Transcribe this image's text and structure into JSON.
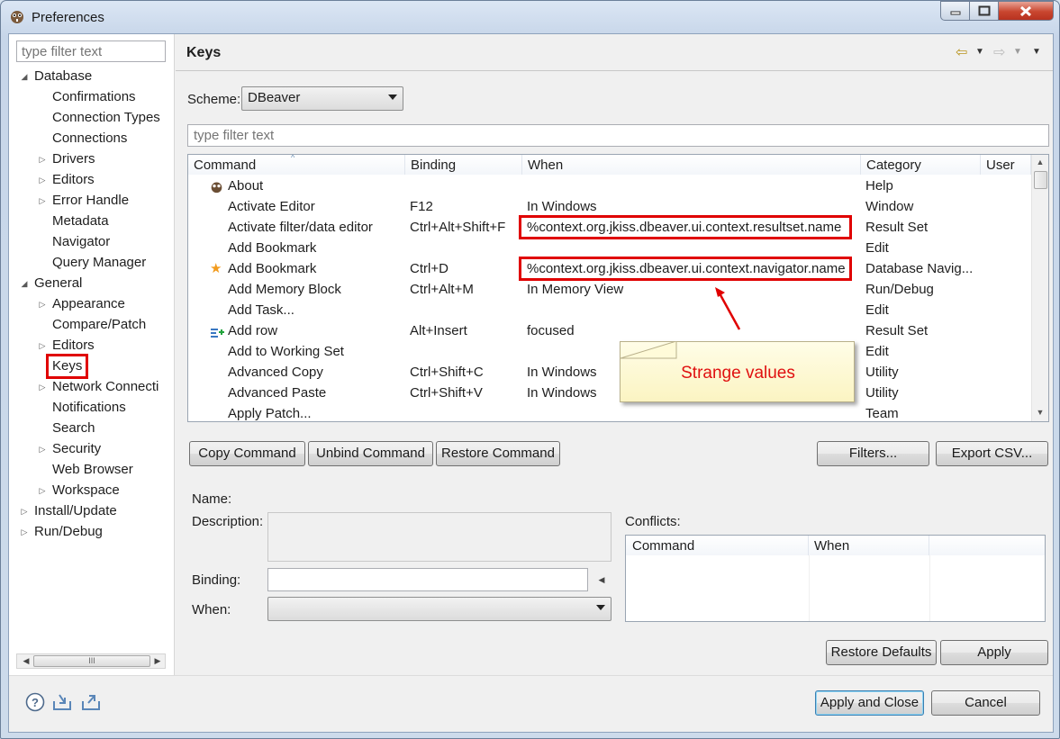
{
  "window": {
    "title": "Preferences"
  },
  "left": {
    "filter_placeholder": "type filter text",
    "tree": [
      {
        "label": "Database",
        "level": 0,
        "expander": "open"
      },
      {
        "label": "Confirmations",
        "level": 1,
        "expander": "none"
      },
      {
        "label": "Connection Types",
        "level": 1,
        "expander": "none"
      },
      {
        "label": "Connections",
        "level": 1,
        "expander": "none"
      },
      {
        "label": "Drivers",
        "level": 1,
        "expander": "closed"
      },
      {
        "label": "Editors",
        "level": 1,
        "expander": "closed"
      },
      {
        "label": "Error Handle",
        "level": 1,
        "expander": "closed"
      },
      {
        "label": "Metadata",
        "level": 1,
        "expander": "none"
      },
      {
        "label": "Navigator",
        "level": 1,
        "expander": "none"
      },
      {
        "label": "Query Manager",
        "level": 1,
        "expander": "none"
      },
      {
        "label": "General",
        "level": 0,
        "expander": "open"
      },
      {
        "label": "Appearance",
        "level": 1,
        "expander": "closed"
      },
      {
        "label": "Compare/Patch",
        "level": 1,
        "expander": "none"
      },
      {
        "label": "Editors",
        "level": 1,
        "expander": "closed"
      },
      {
        "label": "Keys",
        "level": 1,
        "expander": "none",
        "selected": true
      },
      {
        "label": "Network Connecti",
        "level": 1,
        "expander": "closed"
      },
      {
        "label": "Notifications",
        "level": 1,
        "expander": "none"
      },
      {
        "label": "Search",
        "level": 1,
        "expander": "none"
      },
      {
        "label": "Security",
        "level": 1,
        "expander": "closed"
      },
      {
        "label": "Web Browser",
        "level": 1,
        "expander": "none"
      },
      {
        "label": "Workspace",
        "level": 1,
        "expander": "closed"
      },
      {
        "label": "Install/Update",
        "level": 0,
        "expander": "closed"
      },
      {
        "label": "Run/Debug",
        "level": 0,
        "expander": "closed"
      }
    ],
    "scroll_thumb_text": "III"
  },
  "page": {
    "title": "Keys",
    "scheme_label": "Scheme:",
    "scheme_value": "DBeaver",
    "filter_placeholder": "type filter text",
    "columns": [
      "Command",
      "Binding",
      "When",
      "Category",
      "User"
    ],
    "rows": [
      {
        "command": "About",
        "binding": "",
        "when": "",
        "category": "Help",
        "icon": "dbeaver-icon"
      },
      {
        "command": "Activate Editor",
        "binding": "F12",
        "when": "In Windows",
        "category": "Window",
        "icon": ""
      },
      {
        "command": "Activate filter/data editor",
        "binding": "Ctrl+Alt+Shift+F",
        "when": "%context.org.jkiss.dbeaver.ui.context.resultset.name",
        "category": "Result Set",
        "icon": "",
        "flag": true
      },
      {
        "command": "Add Bookmark",
        "binding": "",
        "when": "",
        "category": "Edit",
        "icon": ""
      },
      {
        "command": "Add Bookmark",
        "binding": "Ctrl+D",
        "when": "%context.org.jkiss.dbeaver.ui.context.navigator.name",
        "category": "Database Navig...",
        "icon": "star-icon",
        "flag": true
      },
      {
        "command": "Add Memory Block",
        "binding": "Ctrl+Alt+M",
        "when": "In Memory View",
        "category": "Run/Debug",
        "icon": ""
      },
      {
        "command": "Add Task...",
        "binding": "",
        "when": "",
        "category": "Edit",
        "icon": ""
      },
      {
        "command": "Add row",
        "binding": "Alt+Insert",
        "when": "focused",
        "category": "Result Set",
        "icon": "add-row-icon"
      },
      {
        "command": "Add to Working Set",
        "binding": "",
        "when": "",
        "category": "Edit",
        "icon": ""
      },
      {
        "command": "Advanced Copy",
        "binding": "Ctrl+Shift+C",
        "when": "In Windows",
        "category": "Utility",
        "icon": ""
      },
      {
        "command": "Advanced Paste",
        "binding": "Ctrl+Shift+V",
        "when": "In Windows",
        "category": "Utility",
        "icon": ""
      },
      {
        "command": "Apply Patch...",
        "binding": "",
        "when": "",
        "category": "Team",
        "icon": ""
      }
    ],
    "annotation": "Strange values",
    "buttons": {
      "copy": "Copy Command",
      "unbind": "Unbind Command",
      "restore": "Restore Command",
      "filters": "Filters...",
      "export": "Export CSV..."
    },
    "details": {
      "name_label": "Name:",
      "description_label": "Description:",
      "binding_label": "Binding:",
      "when_label": "When:",
      "conflicts_label": "Conflicts:",
      "conflict_columns": [
        "Command",
        "When"
      ]
    },
    "restore_defaults": "Restore Defaults",
    "apply": "Apply"
  },
  "footer": {
    "apply_close": "Apply and Close",
    "cancel": "Cancel"
  },
  "colors": {
    "highlight": "#e00000",
    "callout_text": "#e01010",
    "callout_bg": "#fbf4c2"
  }
}
